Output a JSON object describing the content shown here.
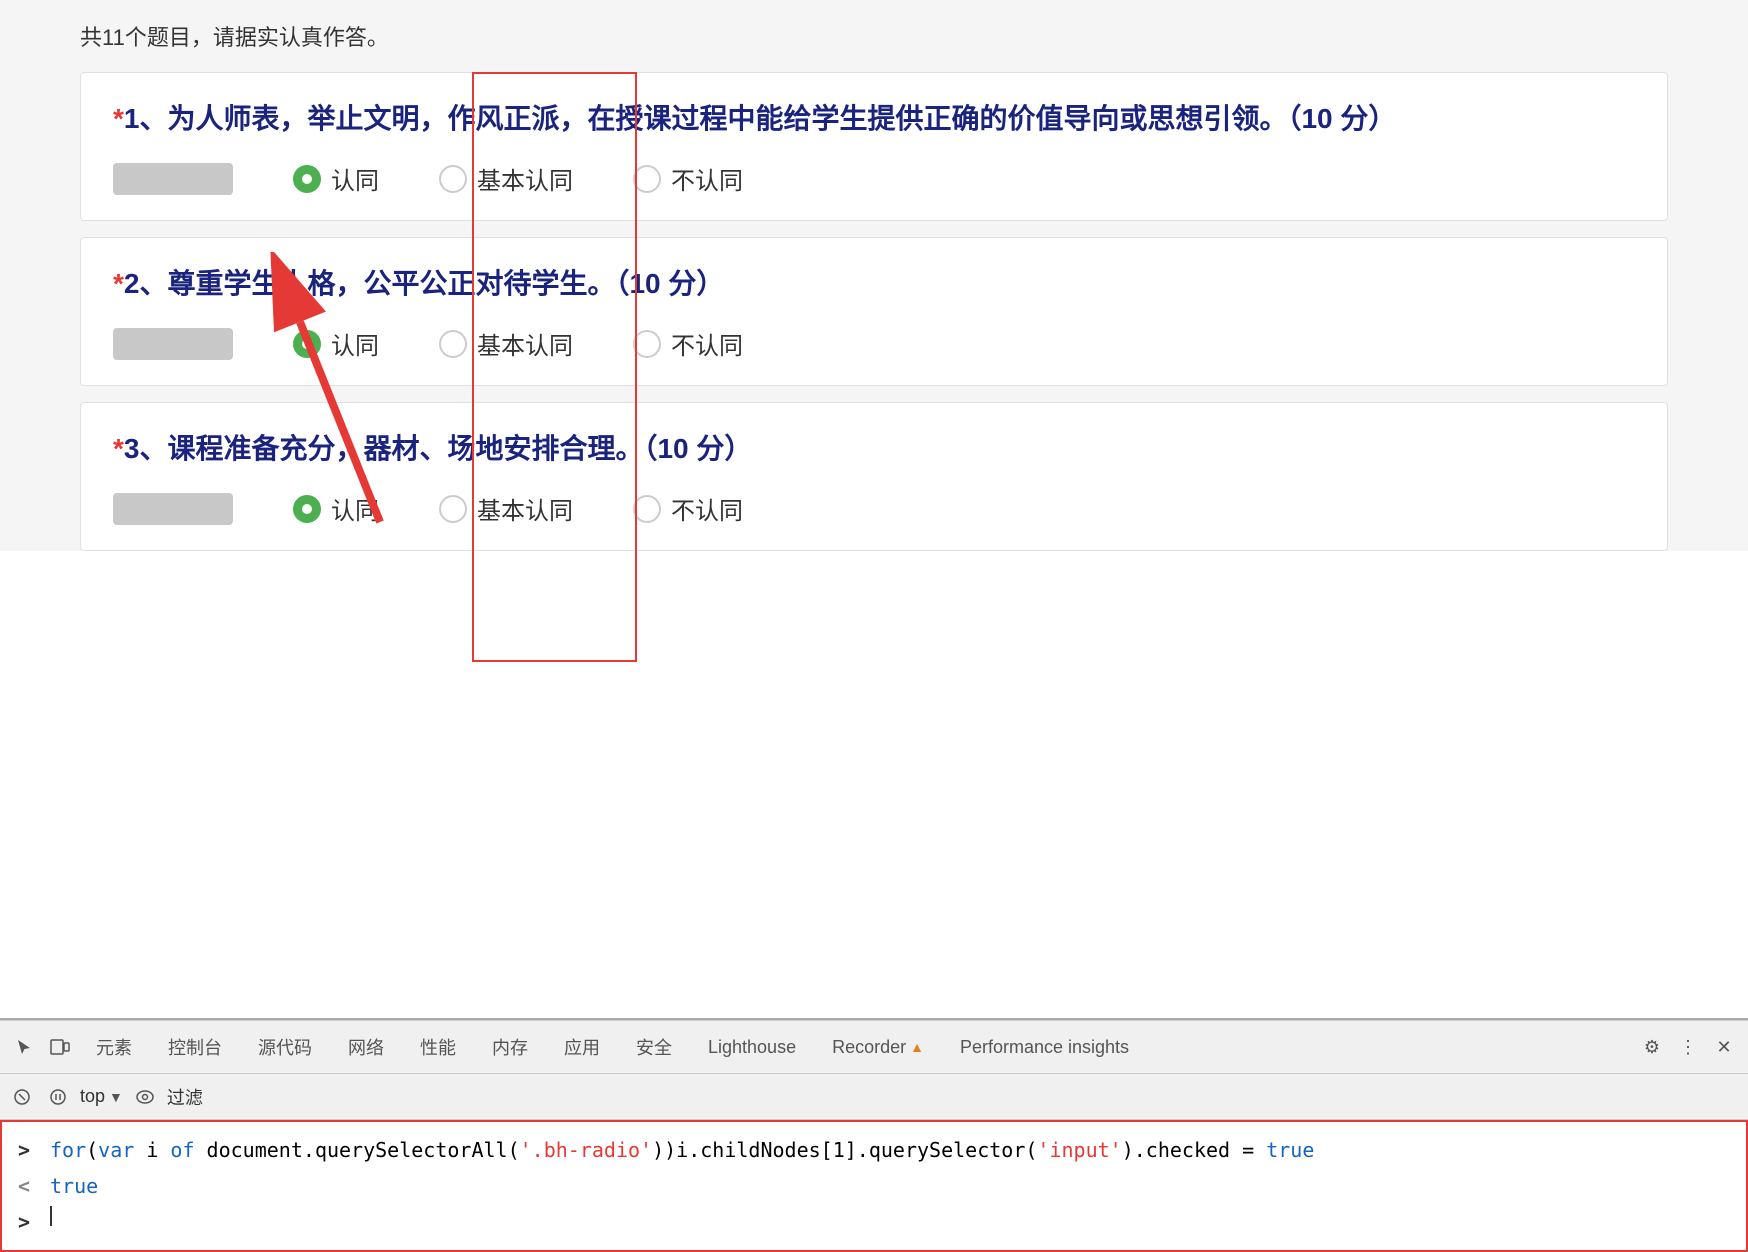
{
  "page": {
    "top_notice": "共11个题目，请据实认真作答。",
    "questions": [
      {
        "id": "q1",
        "number": "1",
        "text": "、为人师表，举止文明，作风正派，在授课过程中能给学生提供正确的价值导向或思想引领。（10 分）",
        "options": [
          "认同",
          "基本认同",
          "不认同"
        ],
        "selected": 0
      },
      {
        "id": "q2",
        "number": "2",
        "text": "、尊重学生人格，公平公正对待学生。（10 分）",
        "options": [
          "认同",
          "基本认同",
          "不认同"
        ],
        "selected": 0
      },
      {
        "id": "q3",
        "number": "3",
        "text": "、课程准备充分，器材、场地安排合理。（10 分）",
        "options": [
          "认同",
          "基本认同",
          "不认同"
        ],
        "selected": 0
      }
    ]
  },
  "devtools": {
    "tabs": [
      {
        "label": "元素",
        "active": false
      },
      {
        "label": "控制台",
        "active": false
      },
      {
        "label": "源代码",
        "active": false
      },
      {
        "label": "网络",
        "active": false
      },
      {
        "label": "性能",
        "active": false
      },
      {
        "label": "内存",
        "active": false
      },
      {
        "label": "应用",
        "active": false
      },
      {
        "label": "安全",
        "active": false
      },
      {
        "label": "Lighthouse",
        "active": false
      },
      {
        "label": "Recorder ▲",
        "active": false
      },
      {
        "label": "Performance insights",
        "active": false
      }
    ],
    "console": {
      "top_label": "top",
      "filter_label": "过滤",
      "code_line": "for(var i of document.querySelectorAll('.bh-radio'))i.childNodes[1].querySelector('input').checked = true",
      "result_line": "true",
      "prompt_in": ">",
      "prompt_out": "<"
    }
  }
}
